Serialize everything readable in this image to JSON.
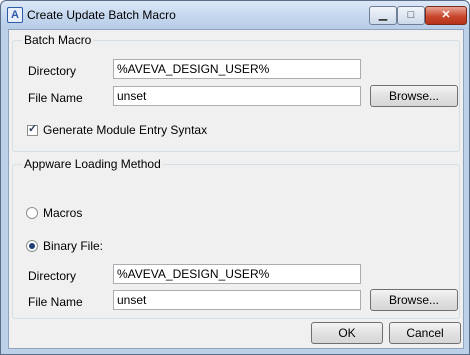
{
  "window": {
    "title": "Create Update Batch Macro",
    "icon": "aveva-app-icon",
    "controls": {
      "minimize": "minimize-icon",
      "maximize": "maximize-icon",
      "close": "close-icon"
    }
  },
  "batch_macro": {
    "group_label": "Batch Macro",
    "directory_label": "Directory",
    "directory_value": "%AVEVA_DESIGN_USER%",
    "filename_label": "File Name",
    "filename_value": "unset",
    "browse_label": "Browse...",
    "generate_checkbox_label": "Generate Module Entry Syntax",
    "generate_checked": true
  },
  "appware": {
    "group_label": "Appware Loading Method",
    "macros_label": "Macros",
    "binary_label": "Binary File:",
    "selected": "binary",
    "directory_label": "Directory",
    "directory_value": "%AVEVA_DESIGN_USER%",
    "filename_label": "File Name",
    "filename_value": "unset",
    "browse_label": "Browse..."
  },
  "footer": {
    "ok_label": "OK",
    "cancel_label": "Cancel"
  }
}
